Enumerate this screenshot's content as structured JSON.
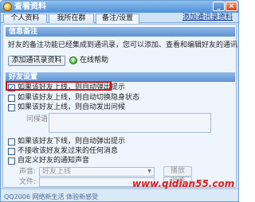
{
  "window": {
    "title": "查看资料",
    "minimize_glyph": "_",
    "close_glyph": "×"
  },
  "tabs": [
    {
      "label": "个人资料",
      "active": false
    },
    {
      "label": "我所在群",
      "active": false
    },
    {
      "label": "备注/设置",
      "active": true
    }
  ],
  "tabs_link": "添加通讯录资料",
  "info_section": {
    "header": "信息备注",
    "description": "好友的备注功能已经集成到通讯录，您可以添加、查看和编辑好友的通讯录资料",
    "add_button": "添加通讯录资料",
    "help_icon": "help-icon",
    "help_link": "在线帮助"
  },
  "friend_section": {
    "header": "好友设置",
    "checkboxes": [
      {
        "label": "如果该好友上线，则自动弹出提示",
        "checked": true,
        "disabled": false
      },
      {
        "label": "如果该好友上线，则自动切换隐身状态",
        "checked": false,
        "disabled": false
      },
      {
        "label": "如果该好友上线，则自动发出问候",
        "checked": false,
        "disabled": false
      },
      {
        "label": "如果该好友下线，则自动弹出提示",
        "checked": false,
        "disabled": false
      },
      {
        "label": "不接收该好友发过来的任何消息",
        "checked": false,
        "disabled": false
      },
      {
        "label": "自定义好友的通知声音",
        "checked": false,
        "disabled": false
      }
    ],
    "greeting_label": "问候语:",
    "sound_label": "声音:",
    "sound_value": "好友上线",
    "play_button": "播放",
    "file_label": "文件:",
    "browse_button": "浏览"
  },
  "status": {
    "text": "QQ2006  网络新生活  体验新感受"
  },
  "watermark": "www.qidian55.com",
  "colors": {
    "accent": "#4f90d8",
    "highlight": "#d21515",
    "watermark": "#d82020"
  }
}
